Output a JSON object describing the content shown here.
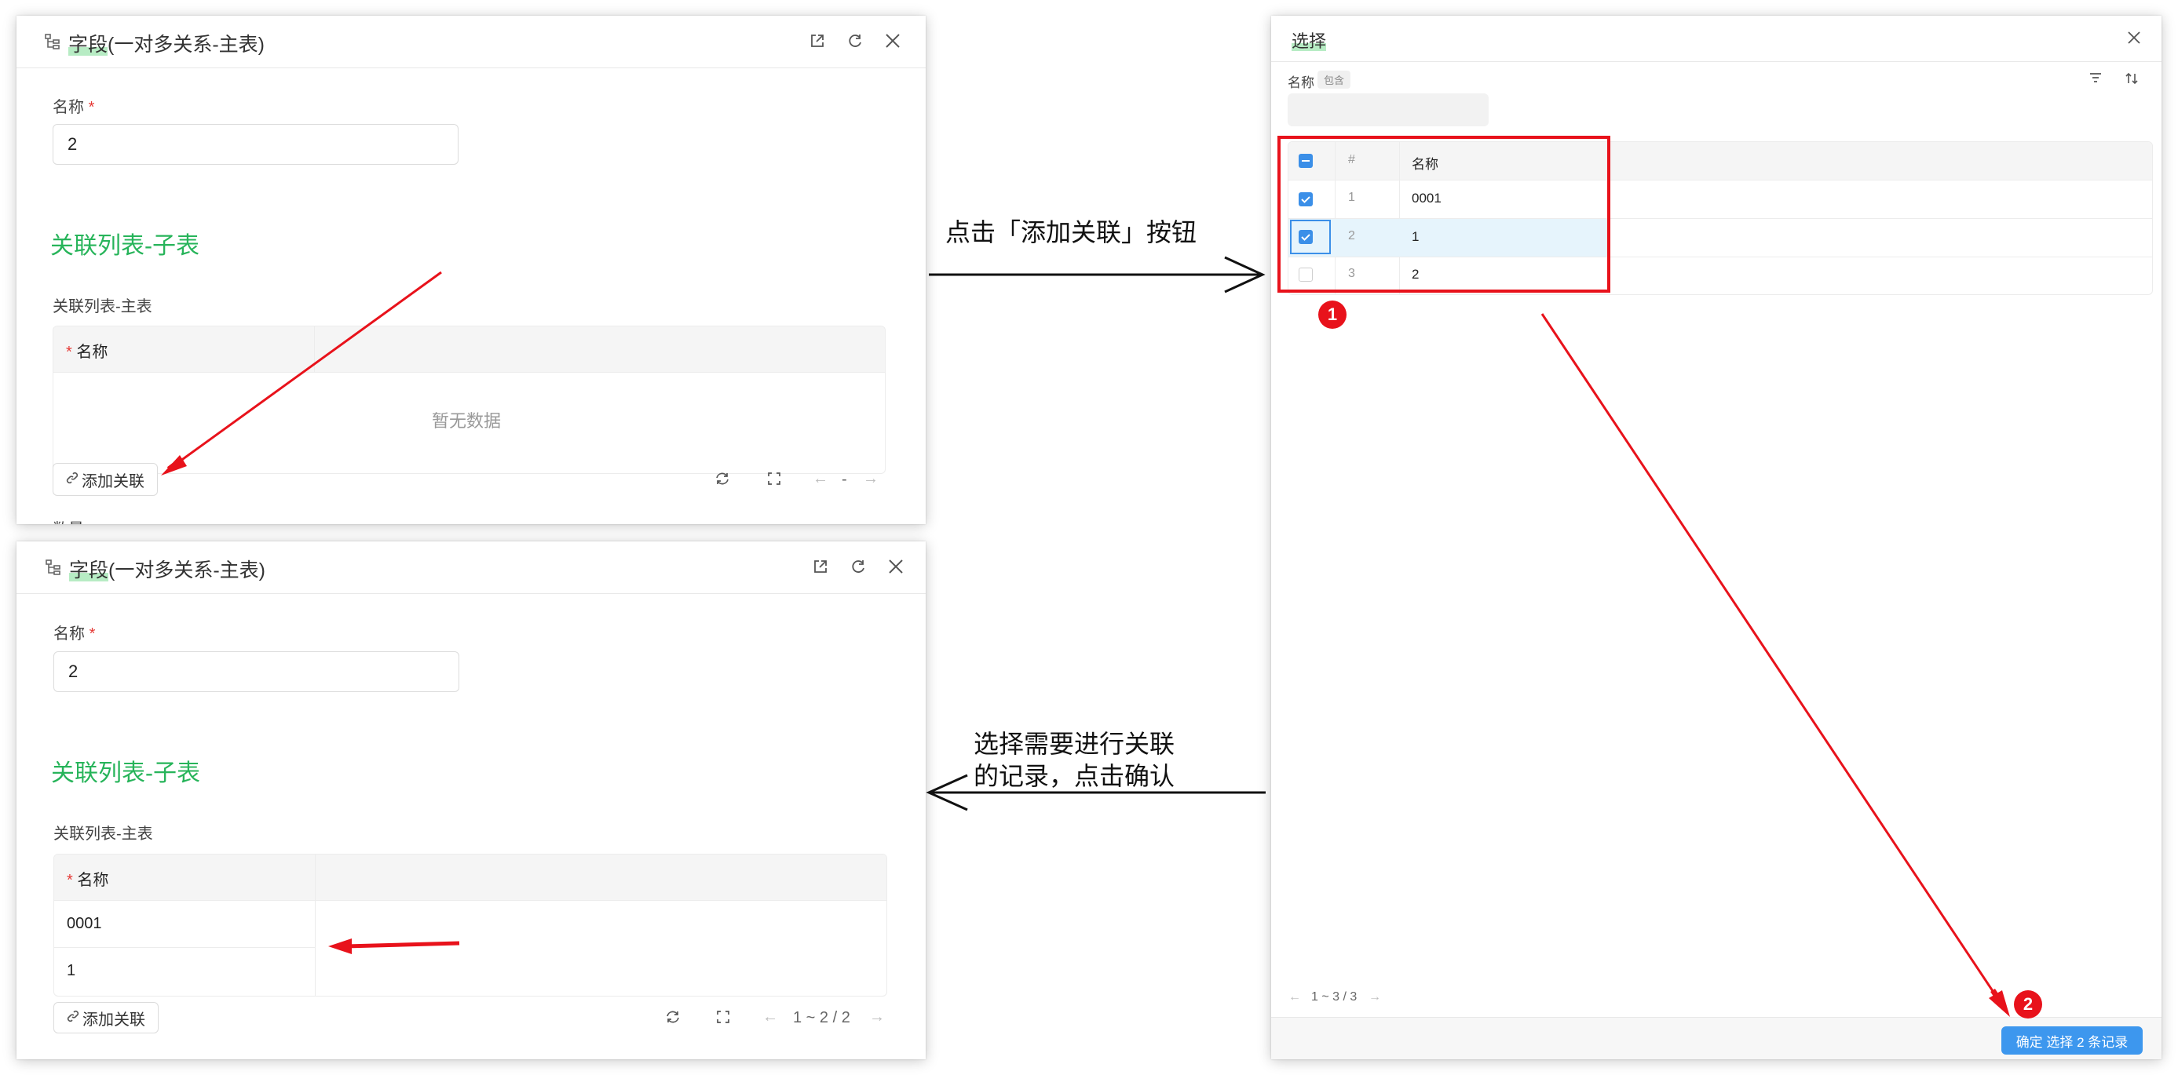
{
  "colors": {
    "accent_green": "#27b45a",
    "primary_blue": "#3d97ee",
    "annotation_red": "#e8121b"
  },
  "panel_top": {
    "title_prefix": "字段",
    "title_suffix": "(一对多关系-主表)",
    "field_label": "名称",
    "required_mark": "*",
    "field_value": "2",
    "section_title": "关联列表-子表",
    "table_label": "关联列表-主表",
    "column_name": "名称",
    "empty_text": "暂无数据",
    "add_button": "添加关联",
    "pager": "-",
    "cut_off_label": "数量",
    "icons": [
      "open-external-icon",
      "refresh-icon",
      "close-icon",
      "link-icon",
      "reload-icon",
      "fullscreen-icon",
      "arrow-left-icon",
      "arrow-right-icon"
    ]
  },
  "panel_bottom": {
    "title_prefix": "字段",
    "title_suffix": "(一对多关系-主表)",
    "field_label": "名称",
    "required_mark": "*",
    "field_value": "2",
    "section_title": "关联列表-子表",
    "table_label": "关联列表-主表",
    "column_name": "名称",
    "rows": [
      "0001",
      "1"
    ],
    "add_button": "添加关联",
    "pager": "1 ~ 2 / 2"
  },
  "select_dialog": {
    "title": "选择",
    "filter_label": "名称",
    "filter_op": "包含",
    "col_index": "#",
    "col_name": "名称",
    "rows": [
      {
        "index": "1",
        "name": "0001",
        "checked": true
      },
      {
        "index": "2",
        "name": "1",
        "checked": true
      },
      {
        "index": "3",
        "name": "2",
        "checked": false
      }
    ],
    "pager": "1 ~ 3 / 3",
    "confirm_button": "确定 选择 2 条记录",
    "icons": [
      "close-icon",
      "filter-icon",
      "sort-icon",
      "arrow-left-icon",
      "arrow-right-icon"
    ]
  },
  "annotations": {
    "step_click_add": "点击「添加关联」按钮",
    "step_select_line1": "选择需要进行关联",
    "step_select_line2": "的记录，点击确认",
    "badge_1": "1",
    "badge_2": "2"
  }
}
